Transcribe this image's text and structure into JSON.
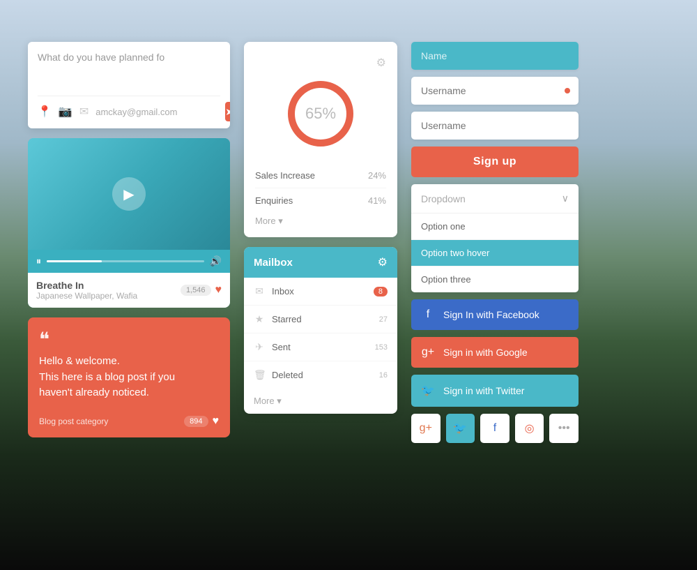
{
  "background": {
    "gradient": "mountain landscape"
  },
  "col1": {
    "text_input": {
      "placeholder": "What do you have planned fo",
      "email_value": "amckay@gmail.com",
      "send_label": "➤"
    },
    "video": {
      "song_title": "Breathe In",
      "song_artist": "Japanese Wallpaper, Wafia",
      "like_count": "1,546"
    },
    "blog": {
      "quote_mark": "❝",
      "text": "Hello & welcome.\nThis here is a blog post if you\nhaven't already noticed.",
      "category": "Blog post category",
      "count": "894"
    }
  },
  "col2": {
    "stats": {
      "gear_icon": "⚙",
      "donut_percent": "65%",
      "rows": [
        {
          "label": "Sales Increase",
          "value": "24%"
        },
        {
          "label": "Enquiries",
          "value": "41%"
        }
      ],
      "more_label": "More ▾"
    },
    "mailbox": {
      "title": "Mailbox",
      "gear_icon": "⚙",
      "items": [
        {
          "icon": "✉",
          "label": "Inbox",
          "badge": "8",
          "badge_type": "red"
        },
        {
          "icon": "★",
          "label": "Starred",
          "count": "27"
        },
        {
          "icon": "✈",
          "label": "Sent",
          "count": "153"
        },
        {
          "icon": "🗑",
          "label": "Deleted",
          "count": "16"
        }
      ],
      "more_label": "More ▾"
    }
  },
  "col3": {
    "form": {
      "name_placeholder": "Name",
      "username_placeholder": "Username",
      "username2_placeholder": "Username",
      "signup_label": "Sign up"
    },
    "dropdown": {
      "label": "Dropdown",
      "arrow": "∨",
      "options": [
        {
          "label": "Option one",
          "hovered": false
        },
        {
          "label": "Option two hover",
          "hovered": true
        },
        {
          "label": "Option three",
          "hovered": false
        }
      ]
    },
    "social_buttons": [
      {
        "label": "Sign In with Facebook",
        "platform": "facebook",
        "icon": "f"
      },
      {
        "label": "Sign in with Google",
        "platform": "google",
        "icon": "g+"
      },
      {
        "label": "Sign in with Twitter",
        "platform": "twitter",
        "icon": "t"
      }
    ],
    "social_icons": [
      {
        "platform": "google",
        "icon": "g+"
      },
      {
        "platform": "twitter",
        "icon": "t"
      },
      {
        "platform": "facebook",
        "icon": "f"
      },
      {
        "platform": "dribbble",
        "icon": "◎"
      },
      {
        "platform": "more",
        "icon": "•••"
      }
    ]
  }
}
